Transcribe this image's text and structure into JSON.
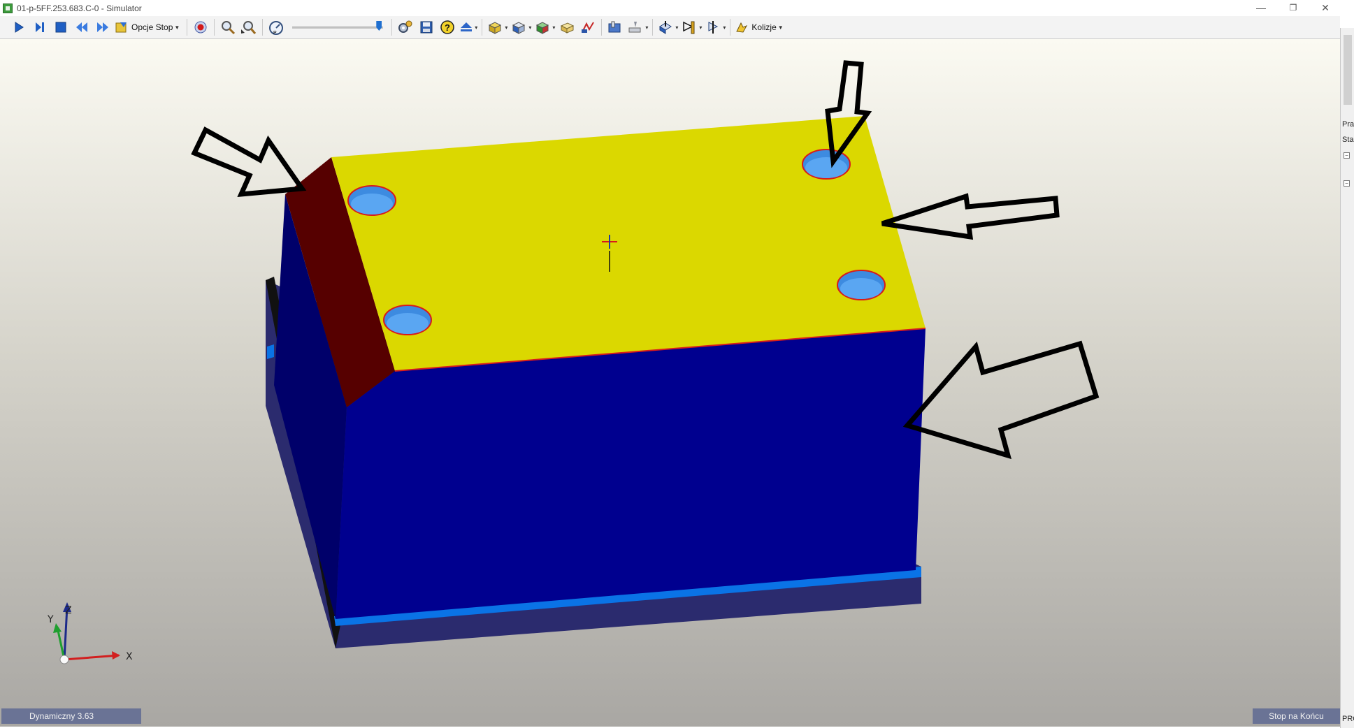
{
  "window": {
    "title": "01-p-5FF.253.683.C-0 - Simulator",
    "minimize": "—",
    "restore": "❐",
    "close": "✕"
  },
  "toolbar": {
    "stop_options_label": "Opcje Stop",
    "collisions_label": "Kolizje",
    "zoom_level": 1.0
  },
  "viewport": {
    "axis_x": "X",
    "axis_y": "Y",
    "axis_z": "Z"
  },
  "status": {
    "left": "Dynamiczny 3.63",
    "right": "Stop na Końcu"
  },
  "side_panel": {
    "label_1": "Pra",
    "label_2": "Sta",
    "label_3": "PRO"
  },
  "colors": {
    "top_face": "#dbd800",
    "front_face": "#00008f",
    "side_face": "#00006a",
    "chamfer_face": "#560000",
    "holes": "#3d8be0",
    "base_stripe": "#0a73e6",
    "base_block": "#2b2b6e",
    "outline": "#000000"
  }
}
